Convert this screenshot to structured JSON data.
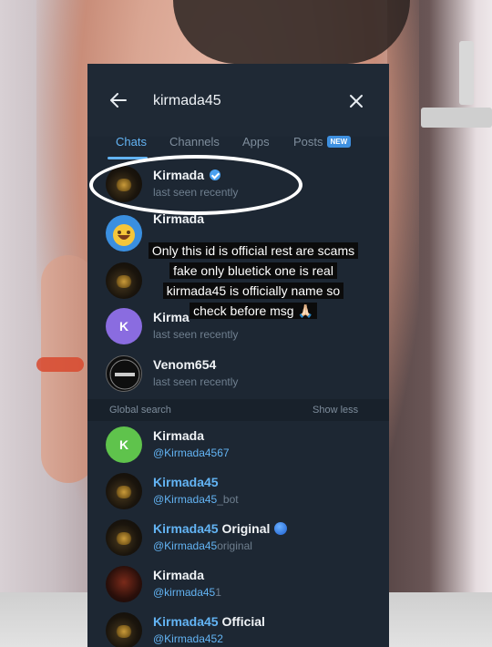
{
  "search": {
    "query": "kirmada45"
  },
  "tabs": [
    {
      "label": "Chats",
      "active": true
    },
    {
      "label": "Channels",
      "active": false
    },
    {
      "label": "Apps",
      "active": false
    },
    {
      "label": "Posts",
      "active": false,
      "badge": "NEW"
    }
  ],
  "chats": [
    {
      "name": "Kirmada",
      "status": "last seen recently",
      "verified": true,
      "avatar": "dark-icon"
    },
    {
      "name": "Kirmada",
      "status": "",
      "avatar": "emoji-icon"
    },
    {
      "name": "",
      "status": "",
      "avatar": "dark-icon"
    },
    {
      "name": "Kirma",
      "status": "last seen recently",
      "avatar_letter": "K",
      "avatar": "purple-letter"
    },
    {
      "name": "Venom654",
      "status": "last seen recently",
      "avatar": "venom-logo"
    }
  ],
  "global": {
    "title": "Global search",
    "toggle": "Show less",
    "results": [
      {
        "name": "Kirmada",
        "handle": "@Kirmada4567",
        "avatar_letter": "K",
        "avatar": "green-letter"
      },
      {
        "name": "Kirmada45",
        "handle": "@Kirmada45",
        "handle_dim": "_bot",
        "avatar": "dark-icon"
      },
      {
        "name": "Kirmada45",
        "name_rest": " Original",
        "handle": "@Kirmada45",
        "handle_dim": "original",
        "avatar": "dark-icon"
      },
      {
        "name": "Kirmada",
        "handle": "@kirmada45",
        "handle_dim": "1",
        "avatar": "red-icon"
      },
      {
        "name": "Kirmada45",
        "name_rest": " Official",
        "handle": "@Kirmada452",
        "avatar": "dark-icon"
      }
    ]
  },
  "overlay": {
    "caption_lines": [
      "Only this id is official rest are scams",
      "fake only bluetick one is real",
      "kirmada45 is officially name so",
      "check before msg 🙏🏻"
    ]
  },
  "colors": {
    "panel_bg": "#1d2733",
    "accent": "#63b4f4",
    "highlight": "#ffffff"
  }
}
